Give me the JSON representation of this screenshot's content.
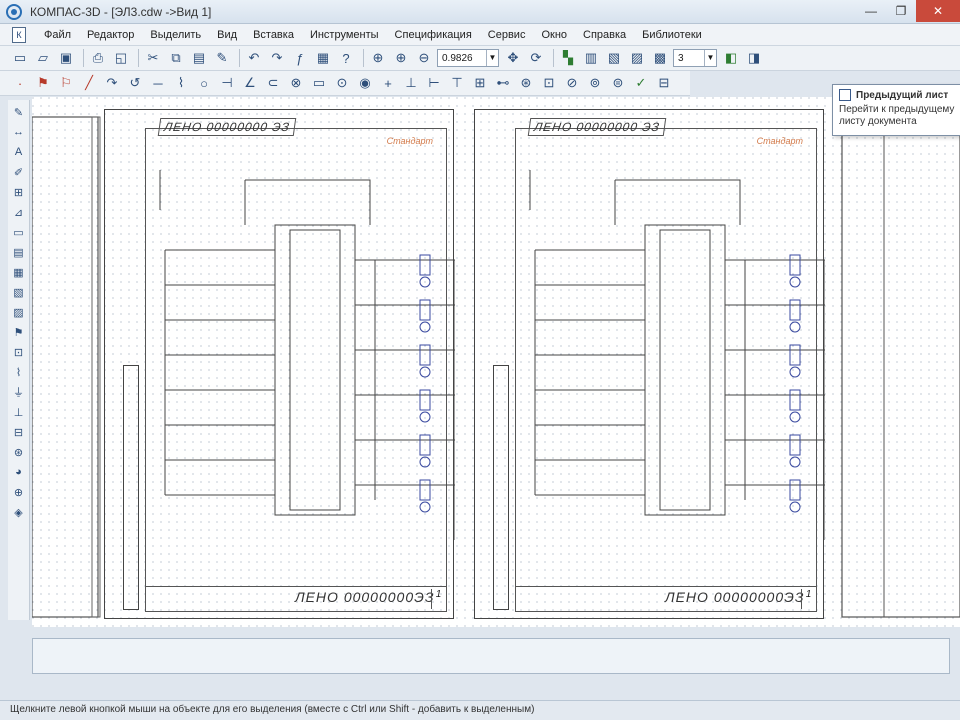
{
  "window": {
    "title": "КОМПАС-3D - [ЭЛ3.cdw ->Вид 1]",
    "minimize": "—",
    "maximize": "❐",
    "close": "✕"
  },
  "menu": {
    "items": [
      "Файл",
      "Редактор",
      "Выделить",
      "Вид",
      "Вставка",
      "Инструменты",
      "Спецификация",
      "Сервис",
      "Окно",
      "Справка",
      "Библиотеки"
    ]
  },
  "toolbar": {
    "scale_value": "0.9826",
    "layer_value": "3"
  },
  "popup": {
    "title": "Предыдущий лист",
    "description": "Перейти к предыдущему листу документа"
  },
  "sheets": [
    {
      "code_top": "ЛЕНО 00000000 ЭЗ",
      "stamp": "Стандарт",
      "code_bottom": "ЛЕНО 00000000ЭЗ",
      "sheet_no": "1"
    },
    {
      "code_top": "ЛЕНО 00000000 ЭЗ",
      "stamp": "Стандарт",
      "code_bottom": "ЛЕНО 00000000ЭЗ",
      "sheet_no": "1"
    }
  ],
  "status": {
    "text": "Щелкните левой кнопкой мыши на объекте для его выделения (вместе с Ctrl или Shift - добавить к выделенным)"
  }
}
